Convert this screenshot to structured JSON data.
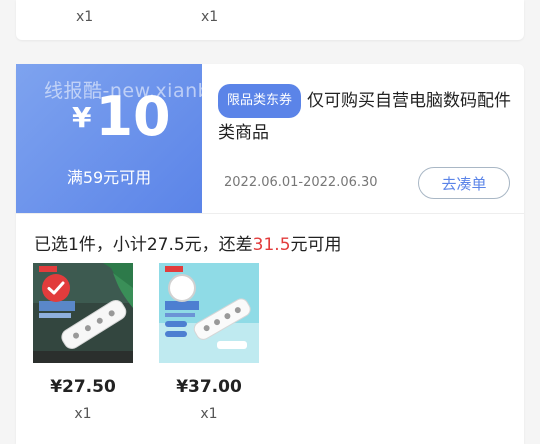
{
  "top_card": {
    "items": [
      {
        "qty": "x1"
      },
      {
        "qty": "x1"
      }
    ]
  },
  "coupon": {
    "watermark": "线报酷-new.xianbao.fun",
    "currency": "¥",
    "amount": "10",
    "condition": "满59元可用",
    "tag": "限品类东券",
    "title": "仅可购买自营电脑数码配件类商品",
    "validity": "2022.06.01-2022.06.30",
    "action_label": "去凑单",
    "colors": {
      "accent": "#5b84e8",
      "highlight": "#e23c3c"
    }
  },
  "summary": {
    "prefix": "已选1件，小计27.5元，还差",
    "diff": "31.5",
    "suffix": "元可用"
  },
  "products": [
    {
      "price": "¥27.50",
      "qty": "x1",
      "icon": "checkmark-badge-icon"
    },
    {
      "price": "¥37.00",
      "qty": "x1",
      "icon": "empty-circle-icon"
    }
  ]
}
